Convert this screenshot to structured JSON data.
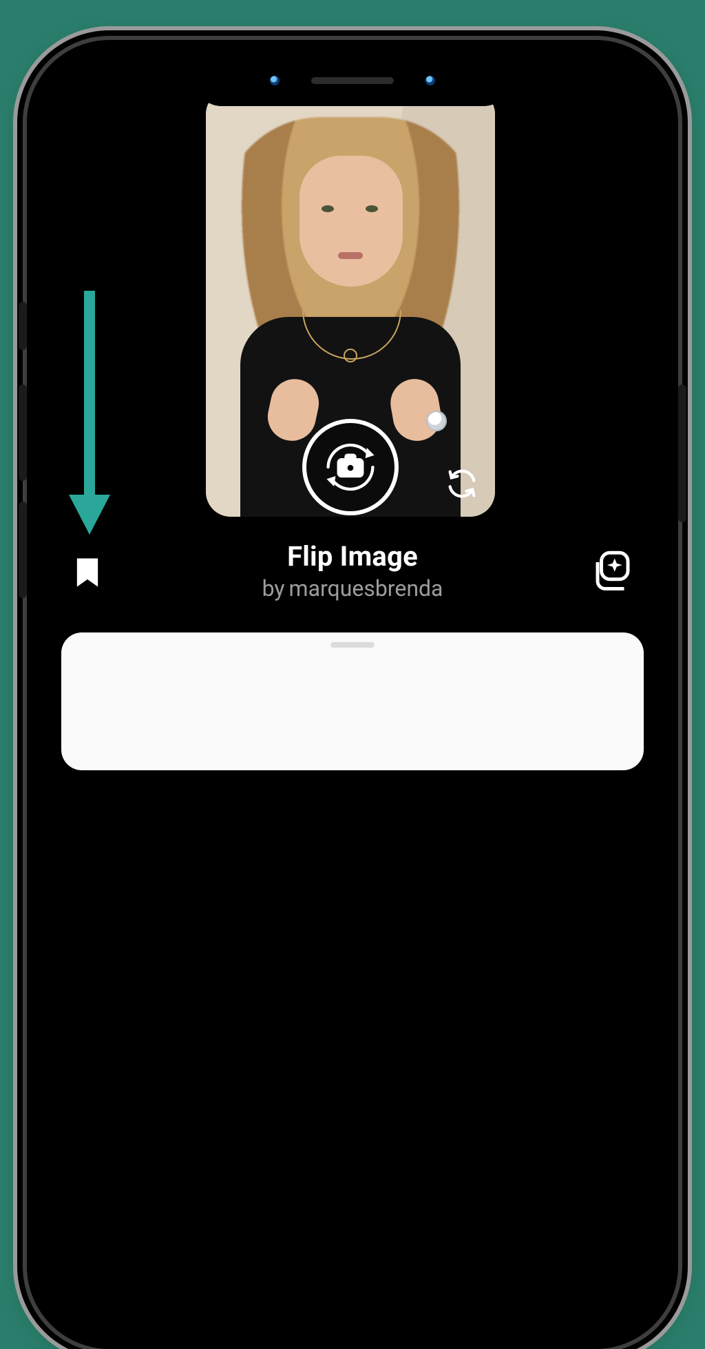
{
  "colors": {
    "page_bg": "#2a7e6b",
    "arrow": "#2aa79a",
    "muted_text": "#9d9d9d"
  },
  "effect": {
    "title": "Flip Image",
    "by_label": "by",
    "author": "marquesbrenda"
  },
  "icons": {
    "save": "bookmark-icon",
    "effects": "sparkle-stack-icon",
    "flip_camera": "rotate-icon",
    "effect_badge": "camera-rotate-icon",
    "annotation_arrow": "arrow-down-icon"
  }
}
